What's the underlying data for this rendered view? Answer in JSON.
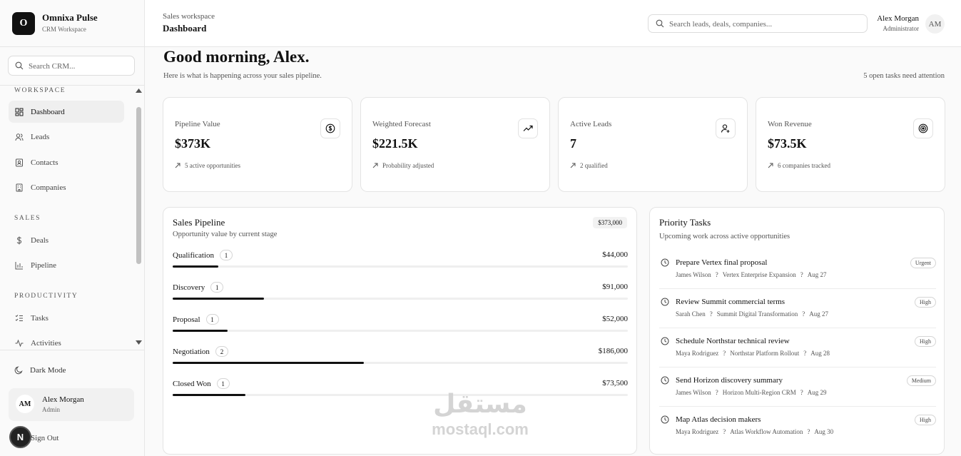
{
  "brand": {
    "logo_letter": "O",
    "name": "Omnixa Pulse",
    "subtitle": "CRM Workspace"
  },
  "sidebar": {
    "search_placeholder": "Search CRM...",
    "sections": [
      {
        "title": "WORKSPACE",
        "items": [
          {
            "label": "Dashboard",
            "icon": "dashboard-icon",
            "active": true
          },
          {
            "label": "Leads",
            "icon": "users-icon"
          },
          {
            "label": "Contacts",
            "icon": "contact-card-icon"
          },
          {
            "label": "Companies",
            "icon": "building-icon"
          }
        ]
      },
      {
        "title": "SALES",
        "items": [
          {
            "label": "Deals",
            "icon": "dollar-icon"
          },
          {
            "label": "Pipeline",
            "icon": "bar-chart-icon"
          }
        ]
      },
      {
        "title": "PRODUCTIVITY",
        "items": [
          {
            "label": "Tasks",
            "icon": "checklist-icon"
          },
          {
            "label": "Activities",
            "icon": "activity-icon"
          }
        ]
      }
    ],
    "dark_mode_label": "Dark Mode",
    "user": {
      "initials": "AM",
      "name": "Alex Morgan",
      "role": "Admin"
    },
    "sign_out_label": "Sign Out",
    "fab_letter": "N"
  },
  "header": {
    "breadcrumb_parent": "Sales workspace",
    "breadcrumb_current": "Dashboard",
    "search_placeholder": "Search leads, deals, companies...",
    "user": {
      "name": "Alex Morgan",
      "role": "Administrator",
      "initials": "AM"
    }
  },
  "greeting": {
    "title": "Good morning, Alex.",
    "subtitle": "Here is what is happening across your sales pipeline.",
    "open_tasks": "5 open tasks need attention"
  },
  "stats": [
    {
      "label": "Pipeline Value",
      "value": "$373K",
      "note": "5 active opportunities",
      "icon": "dollar-circle-icon"
    },
    {
      "label": "Weighted Forecast",
      "value": "$221.5K",
      "note": "Probability adjusted",
      "icon": "trending-up-icon"
    },
    {
      "label": "Active Leads",
      "value": "7",
      "note": "2 qualified",
      "icon": "user-plus-icon"
    },
    {
      "label": "Won Revenue",
      "value": "$73.5K",
      "note": "6 companies tracked",
      "icon": "target-icon"
    }
  ],
  "pipeline": {
    "title": "Sales Pipeline",
    "subtitle": "Opportunity value by current stage",
    "total": "$373,000",
    "stages": [
      {
        "name": "Qualification",
        "count": "1",
        "amount": "$44,000",
        "fraction": 0.1
      },
      {
        "name": "Discovery",
        "count": "1",
        "amount": "$91,000",
        "fraction": 0.2
      },
      {
        "name": "Proposal",
        "count": "1",
        "amount": "$52,000",
        "fraction": 0.12
      },
      {
        "name": "Negotiation",
        "count": "2",
        "amount": "$186,000",
        "fraction": 0.42
      },
      {
        "name": "Closed Won",
        "count": "1",
        "amount": "$73,500",
        "fraction": 0.16
      }
    ]
  },
  "tasks": {
    "title": "Priority Tasks",
    "subtitle": "Upcoming work across active opportunities",
    "items": [
      {
        "title": "Prepare Vertex final proposal",
        "owner": "James Wilson",
        "deal": "Vertex Enterprise Expansion",
        "date": "Aug 27",
        "priority": "Urgent"
      },
      {
        "title": "Review Summit commercial terms",
        "owner": "Sarah Chen",
        "deal": "Summit Digital Transformation",
        "date": "Aug 27",
        "priority": "High"
      },
      {
        "title": "Schedule Northstar technical review",
        "owner": "Maya Rodriguez",
        "deal": "Northstar Platform Rollout",
        "date": "Aug 28",
        "priority": "High"
      },
      {
        "title": "Send Horizon discovery summary",
        "owner": "James Wilson",
        "deal": "Horizon Multi-Region CRM",
        "date": "Aug 29",
        "priority": "Medium"
      },
      {
        "title": "Map Atlas decision makers",
        "owner": "Maya Rodriguez",
        "deal": "Atlas Workflow Automation",
        "date": "Aug 30",
        "priority": "High"
      }
    ],
    "separator": "?"
  },
  "watermark": {
    "arabic": "مستقل",
    "latin": "mostaql.com"
  }
}
